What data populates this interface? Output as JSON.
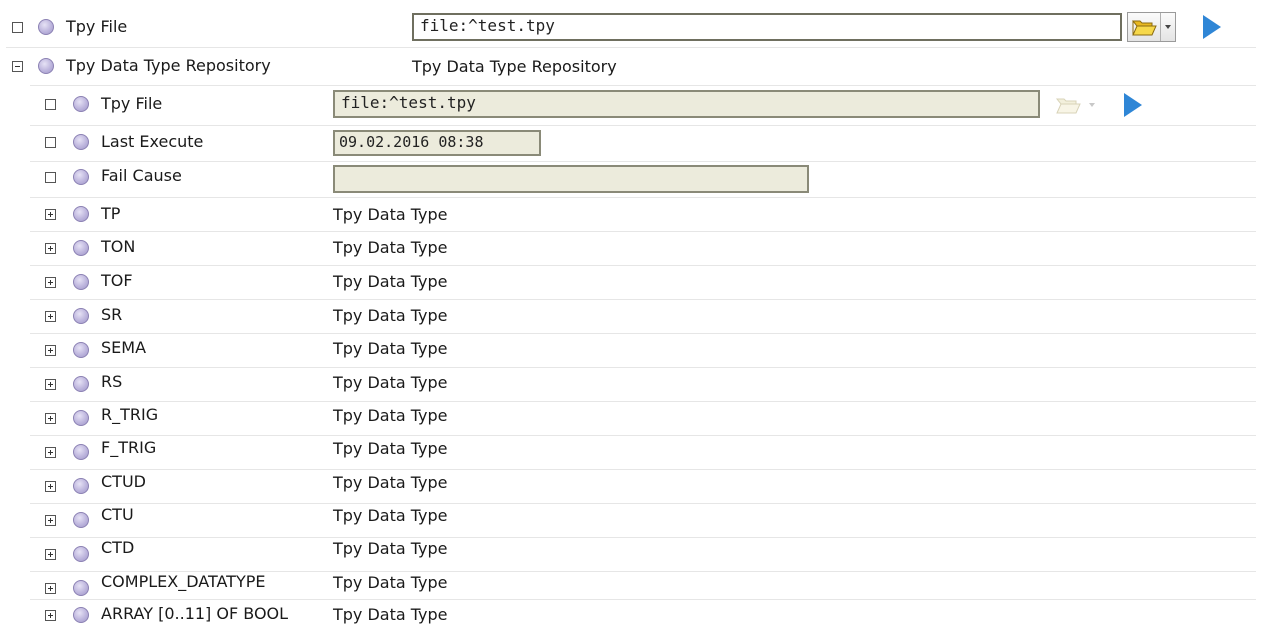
{
  "top": {
    "tpy_file": {
      "label": "Tpy File",
      "value": "file:^test.tpy",
      "folder_icon": "folder-open-icon",
      "run_icon": "play-icon"
    },
    "repository": {
      "label": "Tpy Data Type Repository",
      "value": "Tpy Data Type Repository",
      "tpy_file": {
        "label": "Tpy File",
        "value": "file:^test.tpy"
      },
      "last_execute": {
        "label": "Last Execute",
        "value": "09.02.2016 08:38"
      },
      "fail_cause": {
        "label": "Fail Cause",
        "value": ""
      },
      "types": [
        {
          "label": "TP",
          "value": "Tpy Data Type"
        },
        {
          "label": "TON",
          "value": "Tpy Data Type"
        },
        {
          "label": "TOF",
          "value": "Tpy Data Type"
        },
        {
          "label": "SR",
          "value": "Tpy Data Type"
        },
        {
          "label": "SEMA",
          "value": "Tpy Data Type"
        },
        {
          "label": "RS",
          "value": "Tpy Data Type"
        },
        {
          "label": "R_TRIG",
          "value": "Tpy Data Type"
        },
        {
          "label": "F_TRIG",
          "value": "Tpy Data Type"
        },
        {
          "label": "CTUD",
          "value": "Tpy Data Type"
        },
        {
          "label": "CTU",
          "value": "Tpy Data Type"
        },
        {
          "label": "CTD",
          "value": "Tpy Data Type"
        },
        {
          "label": "COMPLEX_DATATYPE",
          "value": "Tpy Data Type"
        },
        {
          "label": "ARRAY [0..11] OF BOOL",
          "value": "Tpy Data Type"
        }
      ]
    }
  },
  "colors": {
    "bullet": "#bdb5dd",
    "readonly_field": "#ecebdc",
    "play": "#2f86d6",
    "folder": "#f2cf3a"
  }
}
